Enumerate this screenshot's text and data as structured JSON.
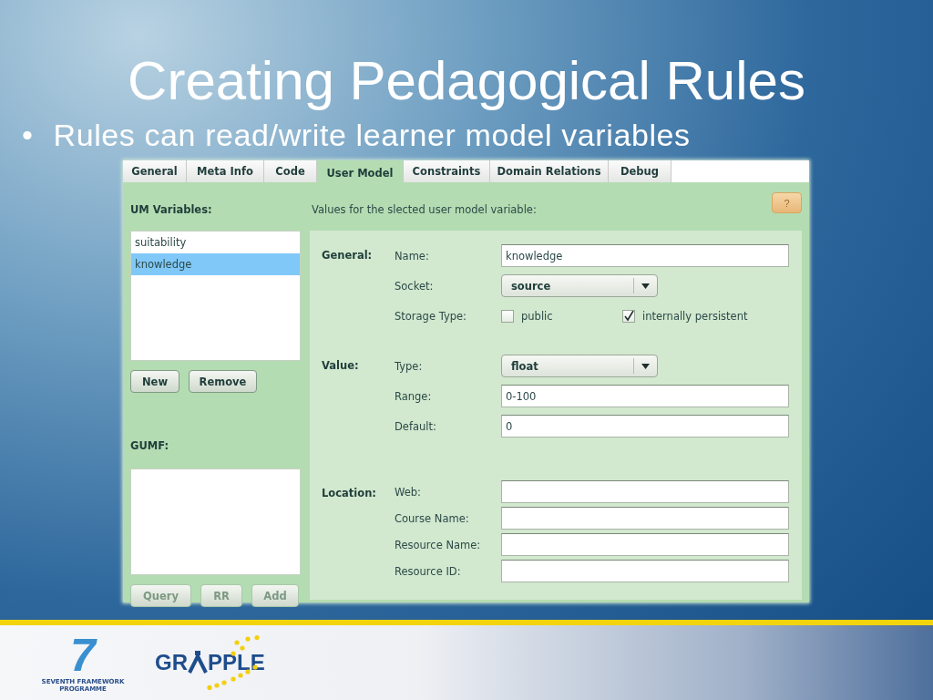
{
  "slide": {
    "title": "Creating Pedagogical Rules",
    "bullets": [
      {
        "marker": "•",
        "text": "Rules can read/write learner model variables"
      }
    ]
  },
  "app": {
    "tabs": [
      {
        "label": "General",
        "selected": false
      },
      {
        "label": "Meta Info",
        "selected": false
      },
      {
        "label": "Code",
        "selected": false
      },
      {
        "label": "User Model",
        "selected": true
      },
      {
        "label": "Constraints",
        "selected": false
      },
      {
        "label": "Domain Relations",
        "selected": false
      },
      {
        "label": "Debug",
        "selected": false
      }
    ],
    "um_variables_label": "UM Variables:",
    "variables": [
      {
        "label": "suitability",
        "selected": false
      },
      {
        "label": "knowledge",
        "selected": true
      }
    ],
    "variable_buttons": [
      {
        "label": "New",
        "disabled": false
      },
      {
        "label": "Remove",
        "disabled": false
      }
    ],
    "gumf_label": "GUMF:",
    "gumf_buttons": [
      {
        "label": "Query",
        "disabled": true
      },
      {
        "label": "RR",
        "disabled": true
      },
      {
        "label": "Add",
        "disabled": true
      }
    ],
    "values_label": "Values for the slected user model variable:",
    "help_button": {
      "label": "?",
      "disabled": true
    },
    "sections": [
      {
        "label": "General:",
        "fields": [
          {
            "kind": "text",
            "label": "Name:",
            "value": "knowledge"
          },
          {
            "kind": "select",
            "label": "Socket:",
            "value": "source"
          },
          {
            "kind": "checks",
            "label": "Storage Type:",
            "options": [
              {
                "label": "public",
                "checked": false
              },
              {
                "label": "internally persistent",
                "checked": true
              }
            ]
          }
        ]
      },
      {
        "label": "Value:",
        "fields": [
          {
            "kind": "select",
            "label": "Type:",
            "value": "float"
          },
          {
            "kind": "text",
            "label": "Range:",
            "value": "0-100"
          },
          {
            "kind": "text",
            "label": "Default:",
            "value": "0"
          }
        ]
      },
      {
        "label": "Location:",
        "fields": [
          {
            "kind": "text",
            "label": "Web:"
          },
          {
            "kind": "text",
            "label": "Course Name:"
          },
          {
            "kind": "text",
            "label": "Resource Name:"
          },
          {
            "kind": "text",
            "label": "Resource ID:"
          }
        ]
      }
    ]
  },
  "footer": {
    "fp7_digit": "7",
    "fp7_caption": [
      "SEVENTH FRAMEWORK",
      "PROGRAMME"
    ],
    "grapple_left": "GR",
    "grapple_right": "PPLE"
  }
}
